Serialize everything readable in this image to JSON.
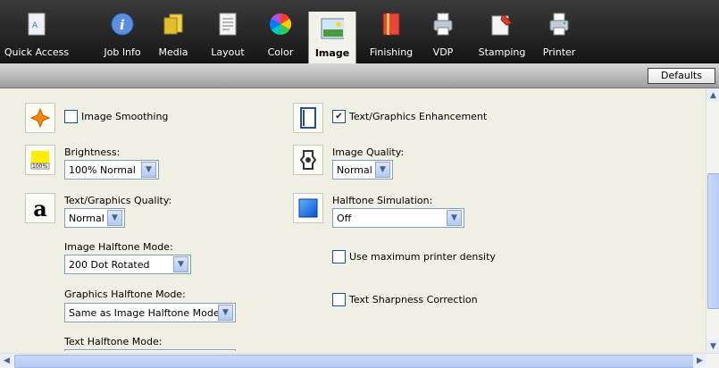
{
  "toolbar": {
    "tabs": [
      {
        "label": "Quick Access",
        "icon": "quick-access-icon"
      },
      {
        "label": "Job Info",
        "icon": "info-icon"
      },
      {
        "label": "Media",
        "icon": "media-icon"
      },
      {
        "label": "Layout",
        "icon": "layout-icon"
      },
      {
        "label": "Color",
        "icon": "color-wheel-icon"
      },
      {
        "label": "Image",
        "icon": "image-icon"
      },
      {
        "label": "Finishing",
        "icon": "finishing-icon"
      },
      {
        "label": "VDP",
        "icon": "vdp-printer-icon"
      },
      {
        "label": "Stamping",
        "icon": "stamping-icon"
      },
      {
        "label": "Printer",
        "icon": "printer-icon"
      }
    ],
    "active_tab": "Image",
    "defaults_label": "Defaults"
  },
  "left": {
    "image_smoothing": {
      "label": "Image Smoothing",
      "checked": false
    },
    "brightness": {
      "label": "Brightness:",
      "value": "100% Normal",
      "icon_text": "100%"
    },
    "text_graphics_quality": {
      "label": "Text/Graphics Quality:",
      "value": "Normal"
    },
    "image_halftone": {
      "label": "Image Halftone Mode:",
      "value": "200 Dot Rotated"
    },
    "graphics_halftone": {
      "label": "Graphics Halftone Mode:",
      "value": "Same as Image Halftone Mode"
    },
    "text_halftone": {
      "label": "Text Halftone Mode:",
      "value": ""
    }
  },
  "right": {
    "text_graphics_enhancement": {
      "label": "Text/Graphics Enhancement",
      "checked": true
    },
    "image_quality": {
      "label": "Image Quality:",
      "value": "Normal"
    },
    "halftone_simulation": {
      "label": "Halftone Simulation:",
      "value": "Off"
    },
    "max_density": {
      "label": "Use maximum printer density",
      "checked": false
    },
    "text_sharpness": {
      "label": "Text Sharpness Correction",
      "checked": false
    }
  },
  "colors": {
    "toolbar_bg": "#1c1c1c",
    "panel_bg": "#f0efe4",
    "scroll_accent": "#b7cbf3"
  }
}
